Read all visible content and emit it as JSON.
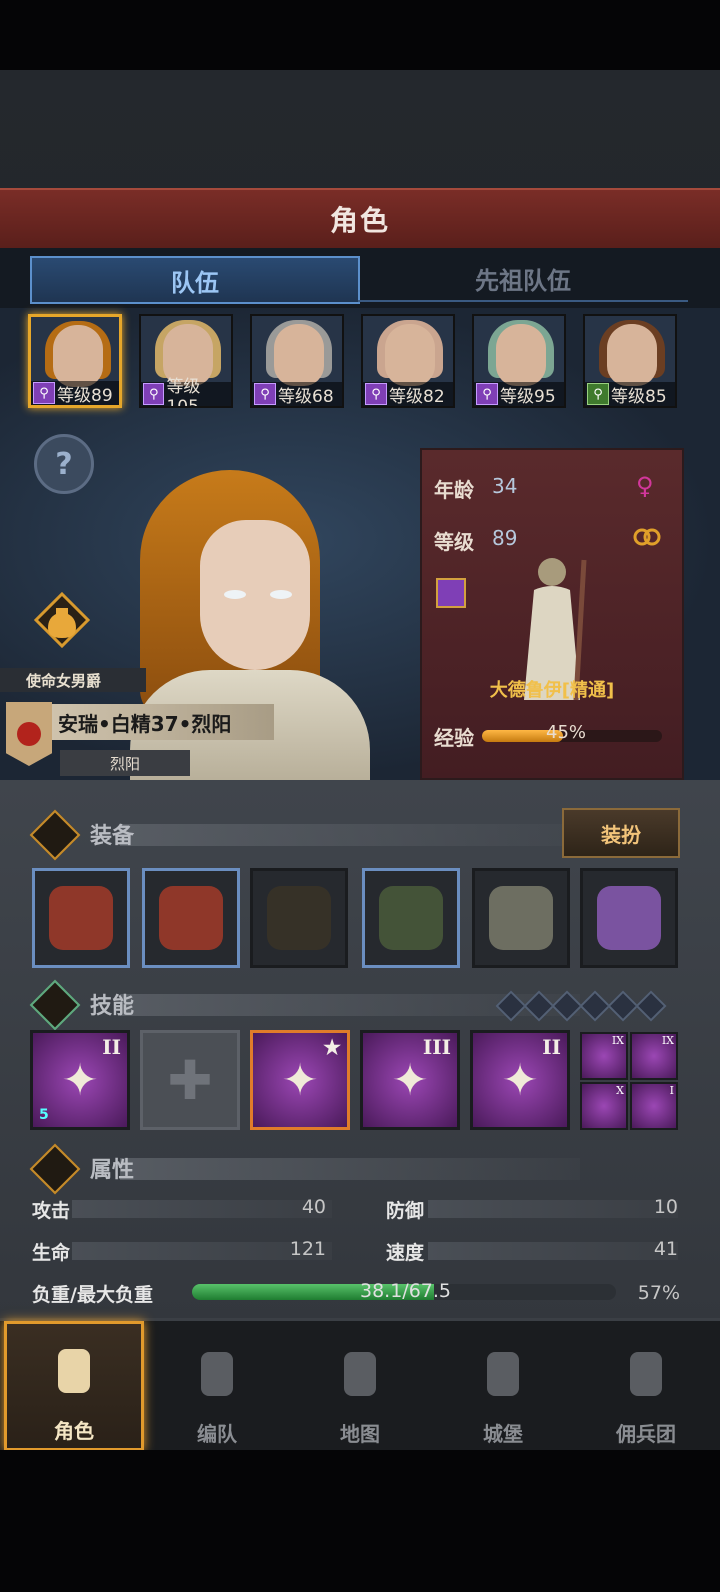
{
  "header": {
    "title": "角色"
  },
  "tabs": [
    {
      "label": "队伍",
      "active": true
    },
    {
      "label": "先祖队伍",
      "active": false
    }
  ],
  "heroes": [
    {
      "level_label": "等级89",
      "class_icon": "staff-icon",
      "selected": true,
      "hair_color": "#b56c14"
    },
    {
      "level_label": "等级105",
      "class_icon": "sword-staff-icon",
      "selected": false,
      "hair_color": "#c6a564"
    },
    {
      "level_label": "等级68",
      "class_icon": "staff-star-icon",
      "selected": false,
      "hair_color": "#9a9a98"
    },
    {
      "level_label": "等级82",
      "class_icon": "staff-icon",
      "selected": false,
      "hair_color": "#caa58f"
    },
    {
      "level_label": "等级95",
      "class_icon": "staff-icon",
      "selected": false,
      "hair_color": "#7ca693"
    },
    {
      "level_label": "等级85",
      "class_icon": "crossed-swords-star-icon",
      "selected": false,
      "hair_color": "#6b3e22"
    }
  ],
  "character": {
    "title": "使命女男爵",
    "name": "安瑞•白精37•烈阳",
    "region": "烈阳"
  },
  "stats_card": {
    "age_label": "年龄",
    "age": "34",
    "gender_icon": "♀",
    "level_label": "等级",
    "level": "89",
    "class_name": "大德鲁伊[精通]",
    "exp_label": "经验",
    "exp_text": "45%",
    "exp_fraction": 0.45
  },
  "equipment": {
    "section_label": "装备",
    "dress_button": "装扮",
    "slots": [
      {
        "name": "thorn-wing-left",
        "highlight": true
      },
      {
        "name": "thorn-wing-right",
        "highlight": true
      },
      {
        "name": "hood",
        "highlight": false
      },
      {
        "name": "tunic",
        "highlight": true
      },
      {
        "name": "boots",
        "highlight": false
      },
      {
        "name": "lavender-wreath",
        "highlight": false
      }
    ]
  },
  "skills": {
    "section_label": "技能",
    "items": [
      {
        "name": "fire-skill",
        "rank": "II",
        "badge": "5"
      },
      {
        "name": "empty-slot",
        "rank": ""
      },
      {
        "name": "tornado-skill",
        "rank": "★"
      },
      {
        "name": "crystal-skill",
        "rank": "III"
      },
      {
        "name": "holy-spear-skill",
        "rank": "II"
      }
    ],
    "mini": [
      {
        "name": "staff-mini",
        "rank": "IX"
      },
      {
        "name": "holy-cross-mini",
        "rank": "IX"
      },
      {
        "name": "burst-mini",
        "rank": "X"
      },
      {
        "name": "shield-mini",
        "rank": "I"
      }
    ]
  },
  "attributes": {
    "section_label": "属性",
    "attack_label": "攻击",
    "attack": "40",
    "defense_label": "防御",
    "defense": "10",
    "life_label": "生命",
    "life": "121",
    "speed_label": "速度",
    "speed": "41",
    "load_label": "负重/最大负重",
    "load_text": "38.1/67.5",
    "load_percent": "57%",
    "load_fraction": 0.57
  },
  "nav": [
    {
      "label": "角色",
      "active": true
    },
    {
      "label": "编队",
      "active": false
    },
    {
      "label": "地图",
      "active": false
    },
    {
      "label": "城堡",
      "active": false
    },
    {
      "label": "佣兵团",
      "active": false
    }
  ],
  "colors": {
    "accent": "#e6a72a",
    "tab_blue": "#5c90cc",
    "title_red": "#7a2d27"
  }
}
